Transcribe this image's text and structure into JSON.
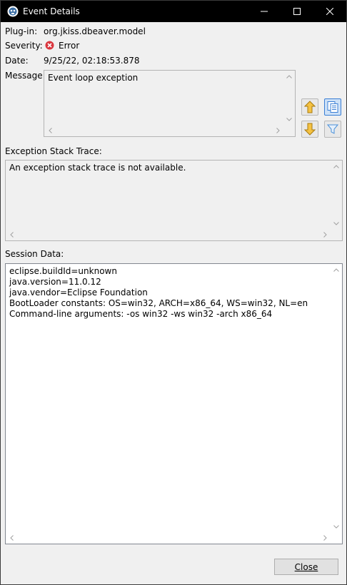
{
  "window": {
    "title": "Event Details"
  },
  "details": {
    "plugin_label": "Plug-in:",
    "plugin_value": "org.jkiss.dbeaver.model",
    "severity_label": "Severity:",
    "severity_value": "Error",
    "date_label": "Date:",
    "date_value": "9/25/22, 02:18:53.878",
    "message_label": "Message:",
    "message_value": "Event loop exception"
  },
  "stack": {
    "label": "Exception Stack Trace:",
    "text": "An exception stack trace is not available."
  },
  "session": {
    "label": "Session Data:",
    "lines": [
      "eclipse.buildId=unknown",
      "java.version=11.0.12",
      "java.vendor=Eclipse Foundation",
      "BootLoader constants: OS=win32, ARCH=x86_64, WS=win32, NL=en",
      "Command-line arguments:  -os win32 -ws win32 -arch x86_64"
    ]
  },
  "buttons": {
    "close_label": "Close"
  },
  "colors": {
    "error": "#d9363e",
    "arrow_yellow": "#f5c242",
    "copy_blue": "#3a7fd5"
  },
  "icons": {
    "app": "dbeaver-icon",
    "previous": "arrow-up-icon",
    "next": "arrow-down-icon",
    "copy": "copy-icon",
    "filter": "filter-icon"
  }
}
